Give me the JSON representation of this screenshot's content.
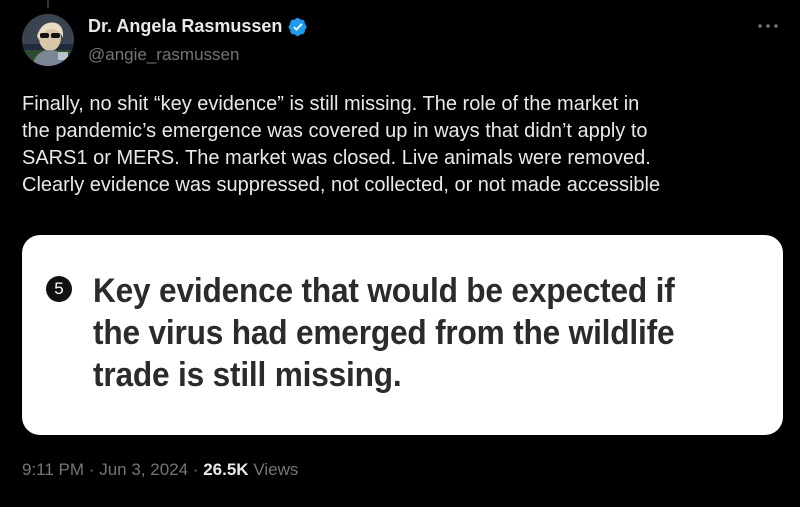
{
  "author": {
    "display_name": "Dr. Angela Rasmussen",
    "handle": "@angie_rasmussen",
    "verified": true,
    "verified_color": "#1d9bf0"
  },
  "tweet": {
    "text_lines": [
      "Finally, no shit “key evidence” is still missing. The role of the market in",
      "the pandemic’s emergence was covered up in ways that didn’t apply to",
      "SARS1 or MERS. The market was closed. Live animals were removed.",
      "Clearly evidence was suppressed, not collected, or not made accessible"
    ]
  },
  "media": {
    "number": "5",
    "heading_lines": [
      "Key evidence that would be expected if",
      "the virus had emerged from the wildlife",
      "trade is still missing."
    ]
  },
  "meta": {
    "time": "9:11 PM",
    "separator": "·",
    "date": "Jun 3, 2024",
    "views_count": "26.5K",
    "views_label": "Views"
  },
  "icons": {
    "more": "more-horizontal-icon",
    "verified": "verified-badge-icon"
  },
  "colors": {
    "background": "#000000",
    "primary_text": "#e7e9ea",
    "secondary_text": "#71767b",
    "card_background": "#ffffff",
    "card_text": "#2b2b2b"
  }
}
